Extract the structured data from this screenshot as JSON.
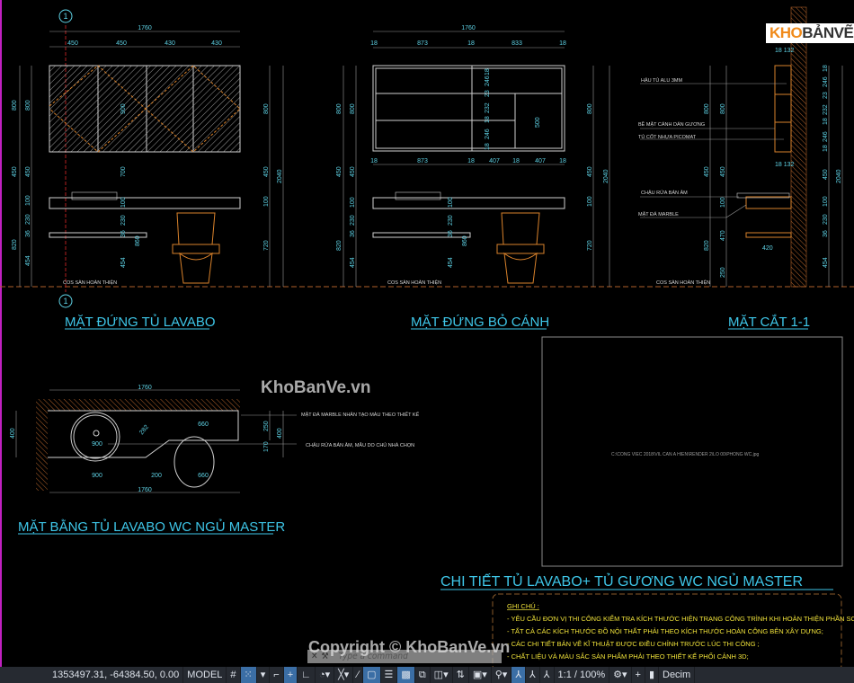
{
  "logo": {
    "part1": "KHO",
    "part2": "BẢNVẼ"
  },
  "section_marker": "1",
  "elevation1": {
    "title": "MẶT ĐỨNG TỦ LAVABO",
    "top_total": "1760",
    "top_dims": [
      "450",
      "450",
      "430",
      "430"
    ],
    "left_dims": [
      "800",
      "800",
      "450",
      "450",
      "100",
      "230",
      "36",
      "820",
      "454"
    ],
    "center_dims": [
      "900",
      "700",
      "100",
      "230",
      "36",
      "454",
      "860"
    ],
    "right_dims": [
      "800",
      "450",
      "100",
      "720",
      "2040"
    ],
    "floor_label": "COS SÀN HOÀN THIỆN"
  },
  "elevation2": {
    "title": "MẶT ĐỨNG BỎ CÁNH",
    "top_total": "1760",
    "top_dims": [
      "18",
      "873",
      "18",
      "833",
      "18"
    ],
    "bottom_dims": [
      "18",
      "873",
      "18",
      "407",
      "18",
      "407",
      "18"
    ],
    "inner_dims": [
      "18",
      "246",
      "23",
      "232",
      "18",
      "246",
      "18",
      "500"
    ],
    "left_dims": [
      "800",
      "800",
      "450",
      "450",
      "100",
      "230",
      "36",
      "820",
      "454"
    ],
    "right_dims": [
      "800",
      "450",
      "100",
      "720",
      "2040"
    ],
    "center_dims": [
      "100",
      "230",
      "36",
      "454",
      "860"
    ],
    "floor_label": "COS SÀN HOÀN THIỆN"
  },
  "section": {
    "title": "MẶT CẮT 1-1",
    "labels": [
      "HẬU TỦ ALU 3MM",
      "BỀ MẶT CÁNH DÁN GƯƠNG",
      "TỦ CỐT NHỰA PICOMAT",
      "CHẬU RỬA BÁN ÂM",
      "MẶT ĐÁ MARBLE"
    ],
    "top_dim": "18 132",
    "mid_dim": "18 132",
    "left_dims": [
      "800",
      "800",
      "450",
      "450",
      "100",
      "820",
      "470",
      "250"
    ],
    "right_dims": [
      "18",
      "246",
      "23",
      "232",
      "18",
      "246",
      "18",
      "450",
      "100",
      "230",
      "36",
      "454",
      "2040"
    ],
    "depth_dim": "420",
    "floor_label": "COS SÀN HOÀN THIỆN"
  },
  "plan": {
    "title": "MẶT BẰNG TỦ LAVABO WC NGỦ MASTER",
    "top_dim": "1760",
    "bottom_dim": "1760",
    "dims": [
      "900",
      "900",
      "200",
      "660",
      "660",
      "282",
      "400",
      "250",
      "170",
      "400"
    ],
    "labels": [
      "MẶT ĐÁ MARBLE NHÂN TẠO MÀU THEO THIẾT KẾ",
      "CHẬU RỬA BÁN ÂM, MẪU DO CHỦ NHÀ CHỌN"
    ]
  },
  "image_frame": {
    "path": "C:\\CONG VIEC 2018\\VIL CAN A HIEN\\RENDER 2\\LO 00\\PHONG WC.jpg"
  },
  "detail_title": "CHI TIẾT TỦ LAVABO+ TỦ GƯƠNG WC NGỦ MASTER",
  "notes": {
    "heading": "GHI CHÚ :",
    "items": [
      "- YÊU CẦU ĐƠN VỊ THI CÔNG KIỂM TRA KÍCH THƯỚC HIỆN TRẠNG CÔNG TRÌNH KHI HOÀN THIỆN PHẦN SƠN BẢ;",
      "- TẤT CẢ CÁC KÍCH THƯỚC ĐỒ NỘI THẤT PHẢI THEO KÍCH THƯỚC HOÀN CÔNG BÊN XÂY DỰNG;",
      "- CÁC CHI TIẾT BẢN VẼ KĨ THUẬT ĐƯỢC ĐIỀU CHỈNH TRƯỚC LÚC THI CÔNG ;",
      "- CHẤT LIỆU VÀ MÀU SẮC SẢN PHẨM PHẢI THEO THIẾT KẾ PHỐI CẢNH 3D;"
    ]
  },
  "watermarks": {
    "center": "KhoBanVe.vn",
    "bottom": "Copyright © KhoBanVe.vn"
  },
  "command_line": {
    "placeholder": "Type a command"
  },
  "statusbar": {
    "coordinates": "1353497.31, -64384.50, 0.00",
    "model": "MODEL",
    "scale": "1:1 / 100%",
    "units": "Decim"
  },
  "colors": {
    "background": "#000000",
    "dimension": "#5fd3e6",
    "furniture": "#d9822b",
    "notes": "#f0e23a",
    "title": "#3ec6e8"
  }
}
